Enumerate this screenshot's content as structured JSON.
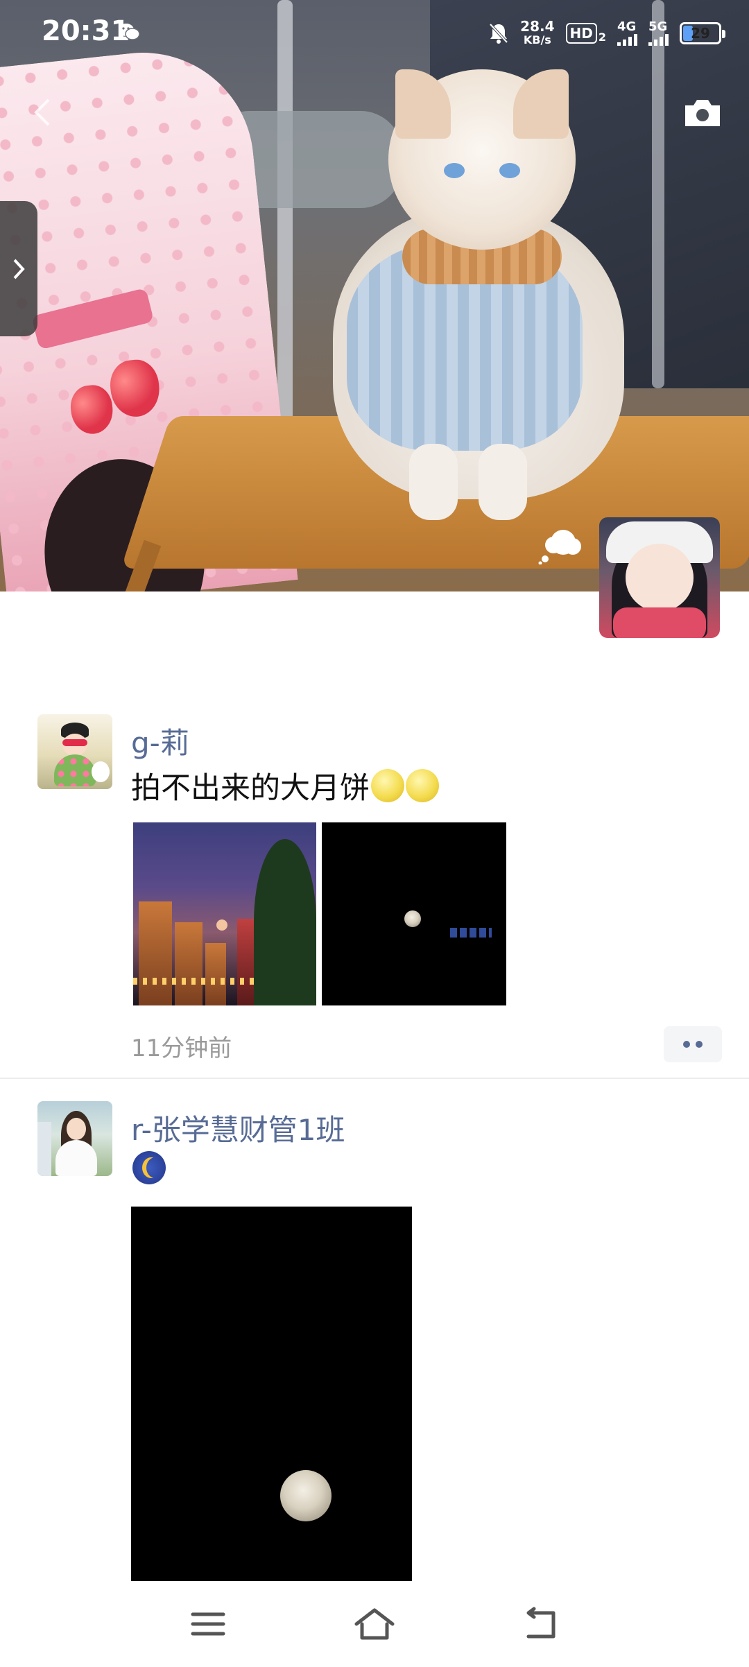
{
  "status_bar": {
    "time": "20:31",
    "speed_value": "28.4",
    "speed_unit": "KB/s",
    "hd_badge": "HD",
    "hd_sub": "2",
    "net1": "4G",
    "net2": "5G",
    "battery": "29",
    "battery_color": "#5da0f5"
  },
  "cover": {
    "camera_icon": "camera-icon",
    "back_icon": "chevron-left-icon",
    "side_tab_icon": "chevron-right-icon"
  },
  "posts": [
    {
      "name": "g-莉",
      "text": "拍不出来的大月饼",
      "emoji": [
        "full-moon-emoji",
        "full-moon-emoji"
      ],
      "time": "11分钟前",
      "photos": [
        "city-night-photo",
        "moon-night-photo"
      ]
    },
    {
      "name": "r-张学慧财管1班",
      "text": "",
      "emoji": [
        "crescent-moon-emoji"
      ],
      "photos": [
        "full-moon-photo"
      ]
    }
  ],
  "nav": {
    "menu_icon": "menu-icon",
    "home_icon": "home-icon",
    "back_icon": "back-icon"
  },
  "colors": {
    "name_link": "#576b95",
    "time_text": "#9a9a9a"
  }
}
